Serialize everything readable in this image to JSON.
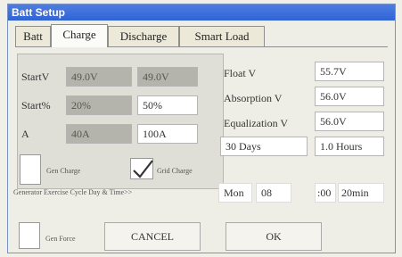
{
  "window": {
    "title": "Batt Setup"
  },
  "tabs": [
    {
      "label": "Batt",
      "active": false
    },
    {
      "label": "Charge",
      "active": true
    },
    {
      "label": "Discharge",
      "active": false
    },
    {
      "label": "Smart Load",
      "active": false
    }
  ],
  "start_panel": {
    "rows": [
      {
        "label": "StartV",
        "min": "49.0V",
        "value": "49.0V"
      },
      {
        "label": "Start%",
        "min": "20%",
        "value": "50%"
      },
      {
        "label": "A",
        "min": "40A",
        "value": "100A"
      }
    ],
    "gen_charge_label": "Gen Charge",
    "gen_charge_checked": false,
    "grid_charge_label": "Grid Charge",
    "grid_charge_checked": true
  },
  "voltages": [
    {
      "label": "Float V",
      "value": "55.7V"
    },
    {
      "label": "Absorption V",
      "value": "56.0V"
    },
    {
      "label": "Equalization V",
      "value": "56.0V"
    }
  ],
  "equalization": {
    "days": "30 Days",
    "hours": "1.0 Hours"
  },
  "exercise": {
    "label": "Generator Exercise Cycle Day & Time>>",
    "day": "Mon",
    "time": "08",
    "minute": ":00",
    "duration": "20min"
  },
  "bottom": {
    "gen_force_label": "Gen Force",
    "gen_force_checked": false,
    "cancel_label": "CANCEL",
    "ok_label": "OK"
  }
}
